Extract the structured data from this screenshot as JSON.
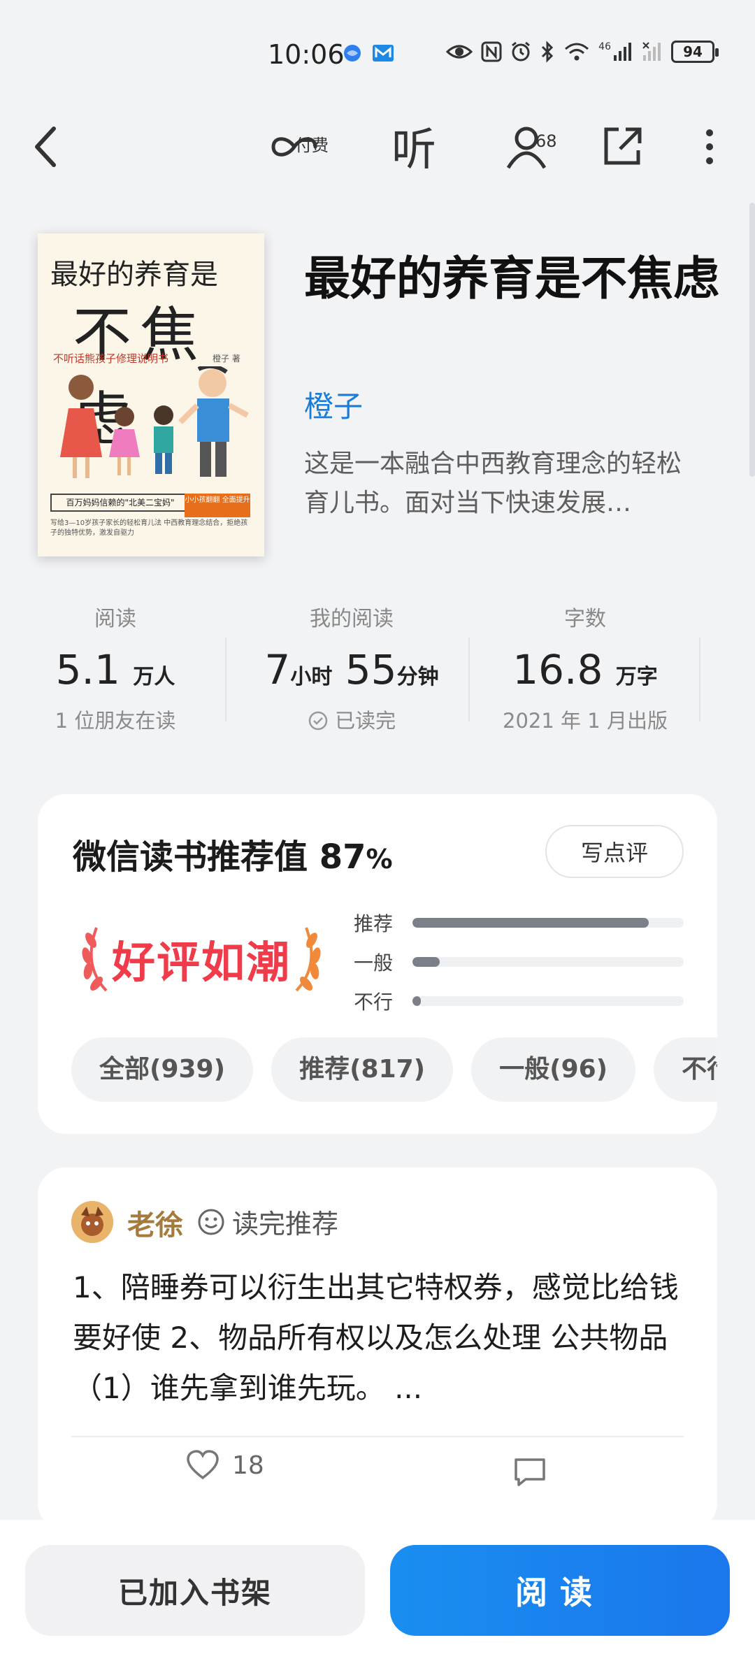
{
  "status_bar": {
    "time": "10:06",
    "network": "46",
    "battery": "94"
  },
  "nav": {
    "pay_label": "付费",
    "listen_label": "听",
    "readers_count": "68"
  },
  "book": {
    "title": "最好的养育是不焦虑",
    "author": "橙子",
    "description": "这是一本融合中西教育理念的轻松育儿书。面对当下快速发展…",
    "cover": {
      "title_line1": "最好的养育是",
      "title_line2": "不焦虑",
      "subtitle": "不听话熊孩子修理说明书",
      "author": "橙子 著",
      "banner": "百万妈妈信赖的\"北美二宝妈\"",
      "badge": "小小孩翻翻 全面提升",
      "fine_print": "写给3—10岁孩子家长的轻松育儿法 中西教育理念结合，拒绝孩子的独特优势，激发自驱力"
    }
  },
  "stats": {
    "reads": {
      "label": "阅读",
      "value": "5.1",
      "unit": "万人",
      "foot": "1 位朋友在读"
    },
    "my_reading": {
      "label": "我的阅读",
      "hours": "7",
      "hours_unit": "小时",
      "minutes": "55",
      "minutes_unit": "分钟",
      "foot": "已读完"
    },
    "words": {
      "label": "字数",
      "value": "16.8",
      "unit": "万字",
      "foot": "2021 年 1 月出版"
    }
  },
  "recommend": {
    "title": "微信读书推荐值",
    "value": "87",
    "percent": "%",
    "write_button": "写点评",
    "badge": "好评如潮",
    "bars": [
      {
        "label": "推荐",
        "fraction": 0.87
      },
      {
        "label": "一般",
        "fraction": 0.1
      },
      {
        "label": "不行",
        "fraction": 0.03
      }
    ],
    "chips": [
      "全部(939)",
      "推荐(817)",
      "一般(96)",
      "不行"
    ]
  },
  "review": {
    "user": "老徐",
    "tag": "读完推荐",
    "body": "1、陪睡券可以衍生出其它特权券，感觉比给钱要好使 2、物品所有权以及怎么处理 公共物品 （1）谁先拿到谁先玩。 ...",
    "likes": "18"
  },
  "bottom": {
    "shelf_button": "已加入书架",
    "read_button": "阅读"
  },
  "colors": {
    "accent": "#1a7dd7",
    "read_button": "#1a8ef0",
    "badge_red": "#ef3b4a",
    "reviewer": "#a57a3d"
  }
}
